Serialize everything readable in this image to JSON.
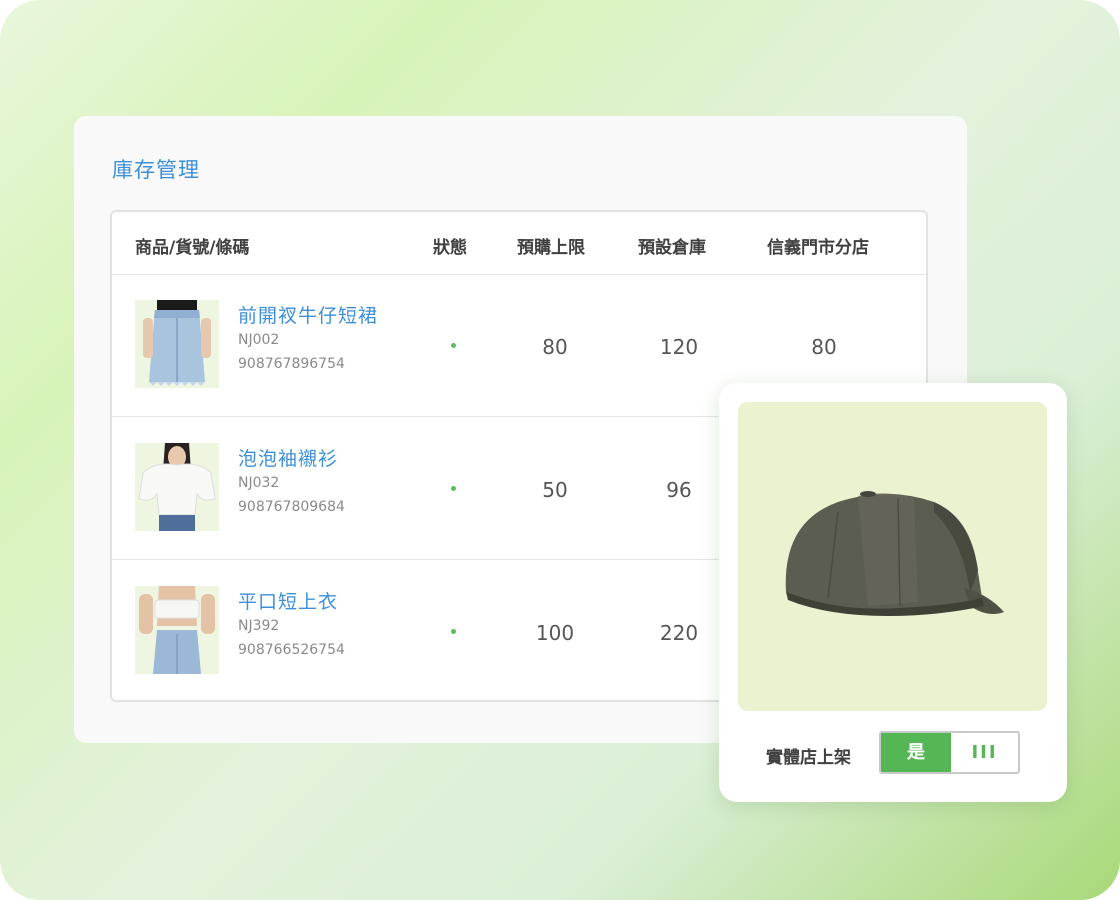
{
  "card": {
    "title": "庫存管理"
  },
  "table": {
    "headers": [
      "商品/貨號/條碼",
      "狀態",
      "預購上限",
      "預設倉庫",
      "信義門市分店"
    ],
    "rows": [
      {
        "name": "前開衩牛仔短裙",
        "sku": "NJ002",
        "barcode": "908767896754",
        "preorder": "80",
        "warehouse": "120",
        "store": "80",
        "image": "denim-skirt-photo"
      },
      {
        "name": "泡泡袖襯衫",
        "sku": "NJ032",
        "barcode": "908767809684",
        "preorder": "50",
        "warehouse": "96",
        "store": "",
        "image": "puff-sleeve-blouse-photo"
      },
      {
        "name": "平口短上衣",
        "sku": "NJ392",
        "barcode": "908766526754",
        "preorder": "100",
        "warehouse": "220",
        "store": "",
        "image": "tube-top-photo"
      }
    ]
  },
  "popup": {
    "image": "baseball-cap-photo",
    "toggle_label": "實體店上架",
    "toggle_on": "是",
    "toggle_off": "III"
  },
  "colors": {
    "accent_blue": "#3d8fd8",
    "accent_green": "#55b655",
    "thumb_bg": "#e9f3d8"
  }
}
